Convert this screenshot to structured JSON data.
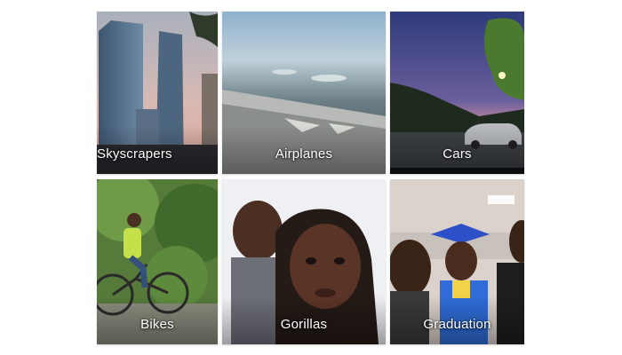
{
  "photo_categories": [
    {
      "label": "Skyscrapers"
    },
    {
      "label": "Airplanes"
    },
    {
      "label": "Cars"
    },
    {
      "label": "Bikes"
    },
    {
      "label": "Gorillas"
    },
    {
      "label": "Graduation"
    }
  ],
  "colors": {
    "label_text": "#ffffff",
    "page_background": "#ffffff"
  }
}
